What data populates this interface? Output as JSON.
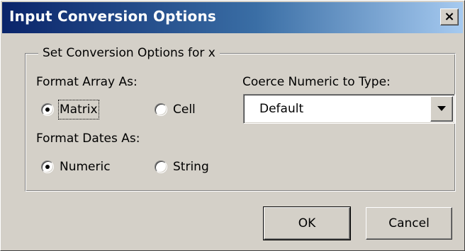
{
  "window": {
    "title": "Input Conversion Options",
    "close_label": "×"
  },
  "group": {
    "legend": "Set Conversion Options for x"
  },
  "format_array": {
    "label": "Format Array As:",
    "options": [
      {
        "label": "Matrix",
        "checked": true
      },
      {
        "label": "Cell",
        "checked": false
      }
    ]
  },
  "coerce": {
    "label": "Coerce Numeric to Type:",
    "selected": "Default"
  },
  "format_dates": {
    "label": "Format Dates As:",
    "options": [
      {
        "label": "Numeric",
        "checked": true
      },
      {
        "label": "String",
        "checked": false
      }
    ]
  },
  "buttons": {
    "ok": "OK",
    "cancel": "Cancel"
  },
  "colors": {
    "titlebar_start": "#0a246a",
    "titlebar_end": "#a6caf0",
    "face": "#d4d0c8"
  }
}
